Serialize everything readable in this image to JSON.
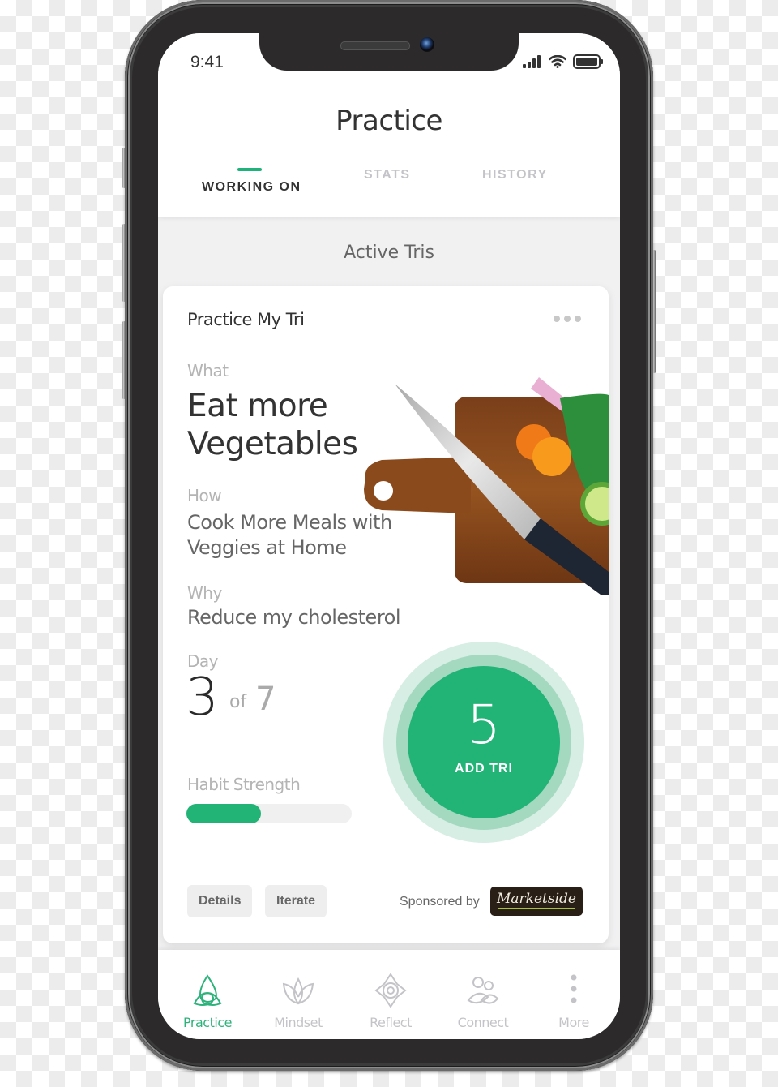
{
  "status_bar": {
    "time": "9:41"
  },
  "header": {
    "title": "Practice",
    "tabs": [
      {
        "label": "WORKING ON",
        "active": true
      },
      {
        "label": "STATS",
        "active": false
      },
      {
        "label": "HISTORY",
        "active": false
      }
    ]
  },
  "section_title": "Active Tris",
  "card": {
    "title": "Practice My Tri",
    "what_label": "What",
    "what": "Eat more Vegetables",
    "how_label": "How",
    "how": "Cook More Meals with Veggies at Home",
    "why_label": "Why",
    "why": "Reduce my cholesterol",
    "day_label": "Day",
    "day_current": "3",
    "day_of": "of",
    "day_total": "7",
    "habit_label": "Habit Strength",
    "habit_strength_percent": 45,
    "add_count": "5",
    "add_label": "ADD TRI",
    "details_label": "Details",
    "iterate_label": "Iterate",
    "sponsored_label": "Sponsored by",
    "sponsor_name": "Marketside"
  },
  "tabbar": [
    {
      "label": "Practice",
      "icon": "triquetra-icon",
      "active": true
    },
    {
      "label": "Mindset",
      "icon": "lotus-icon",
      "active": false
    },
    {
      "label": "Reflect",
      "icon": "compass-eye-icon",
      "active": false
    },
    {
      "label": "Connect",
      "icon": "people-icon",
      "active": false
    },
    {
      "label": "More",
      "icon": "more-vertical-icon",
      "active": false
    }
  ],
  "colors": {
    "accent": "#22b377",
    "inactive": "#c4c4c8",
    "text": "#333333"
  }
}
